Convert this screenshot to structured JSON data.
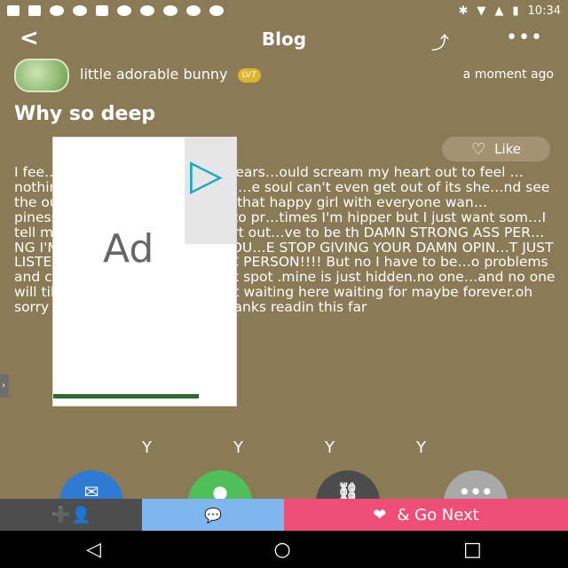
{
  "status": {
    "time": "10:34",
    "battery_icon": "battery-icon"
  },
  "header": {
    "back_label": "<",
    "title": "Blog",
    "share_icon": "share-icon",
    "more_icon": "more-icon"
  },
  "post": {
    "author_name": "little adorable bunny",
    "badge": "LV7",
    "timestamp": "a moment ago",
    "title": "Why so deep",
    "like_label": "Like",
    "body": "I fee…disappearing into my on tears…ould scream my heart out to feel …nothing .I feel like I'm just a soul…e soul can't even get out of its she…nd see the outside.😳 why am I so d…y that happy girl with everyone wan…piness.thats a total lie I just try to pr…times I'm hipper but I just want som…I tell me it's okay to cry your heart out…ve to be th DAMN STRONG ASS PER…NG I'M WEAK I'M WEAK CAN'T YOU…E STOP GIVING YOUR DAMN OPIN…T JUST LISTEN TO MY WORDS CON…TIC PERSON!!!! But no I have to be…o problems and can withstand anyt…a weak spot .mine is just hidden.no one…and no one will till that person come I'm just waiting here waiting for maybe forever.oh sorry I'm just bothering u but thanks readin this far"
  },
  "ad": {
    "label": "Ad"
  },
  "bottom": {
    "follow_label": "+",
    "chat_label": "...",
    "next_label": "& Go Next"
  }
}
